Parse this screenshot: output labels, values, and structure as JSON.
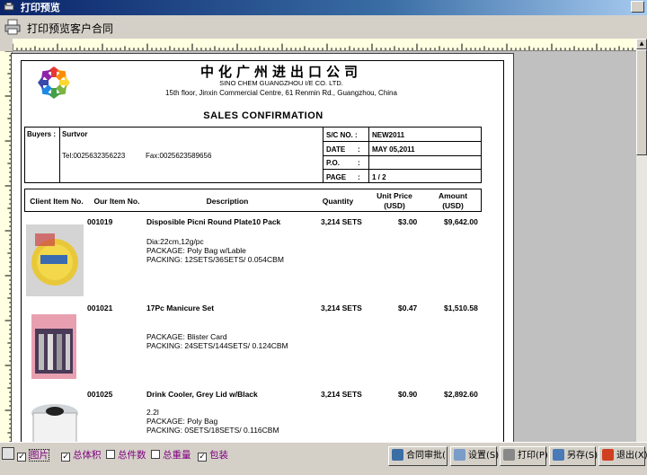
{
  "window": {
    "title": "打印预览"
  },
  "toolbar": {
    "title": "打印预览客户合同"
  },
  "document": {
    "company_cn": "中化广州进出口公司",
    "company_en": "SINO CHEM GUANGZHOU I/E CO. LTD.",
    "address": "15th floor, Jinxin Commercial Centre, 61 Renmin Rd., Guangzhou, China",
    "doc_title": "SALES CONFIRMATION",
    "buyers_label": "Buyers :",
    "buyer_name": "Surtvor",
    "tel": "Tel:0025632356223",
    "fax": "Fax:0025623589656",
    "sc_label": "S/C NO. :",
    "sc_value": "NEW2011",
    "date_label": "DATE",
    "date_colon": ":",
    "date_value": "MAY 05,2011",
    "po_label": "P.O.",
    "po_colon": ":",
    "po_value": "",
    "page_label": "PAGE",
    "page_colon": ":",
    "page_value": "1 / 2"
  },
  "columns": {
    "client_item": "Client Item No.",
    "our_item": "Our Item No.",
    "description": "Description",
    "quantity": "Quantity",
    "unit_price_1": "Unit Price",
    "unit_price_2": "(USD)",
    "amount_1": "Amount",
    "amount_2": "(USD)"
  },
  "items": [
    {
      "our_no": "001019",
      "name": "Disposible Picni Round Plate10 Pack",
      "qty": "3,214 SETS",
      "price": "$3.00",
      "amount": "$9,642.00",
      "line1": "Dia:22cm,12g/pc",
      "line2": "PACKAGE: Poly Bag w/Lable",
      "line3": "PACKING:   12SETS/36SETS/ 0.054CBM"
    },
    {
      "our_no": "001021",
      "name": "17Pc Manicure Set",
      "qty": "3,214 SETS",
      "price": "$0.47",
      "amount": "$1,510.58",
      "line1": "PACKAGE: Blister Card",
      "line2": "PACKING:   24SETS/144SETS/ 0.124CBM",
      "line3": ""
    },
    {
      "our_no": "001025",
      "name": "Drink Cooler, Grey Lid w/Black",
      "qty": "3,214 SETS",
      "price": "$0.90",
      "amount": "$2,892.60",
      "line1": "2.2l",
      "line2": "PACKAGE: Poly Bag",
      "line3": "PACKING:   0SETS/18SETS/ 0.116CBM"
    }
  ],
  "bottom": {
    "chk_picture": "图片",
    "chk_volume": "总体积",
    "chk_pieces": "总件数",
    "chk_weight": "总重量",
    "chk_packing": "包装",
    "btn_approve": "合同审批(",
    "btn_settings": "设置(S)",
    "btn_print": "打印(P)",
    "btn_saveas": "另存(S)",
    "btn_exit": "退出(X)"
  },
  "colors": {
    "titlebar": "#0a246a",
    "checkbox_text": "#800080",
    "window_bg": "#d4d0c8"
  }
}
